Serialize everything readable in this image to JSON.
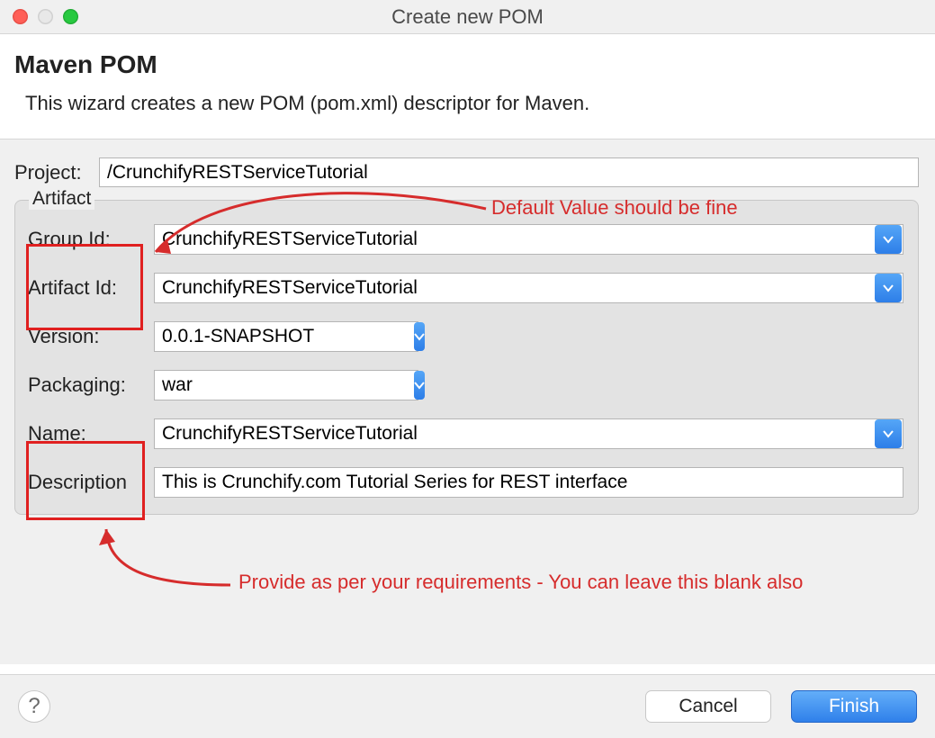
{
  "window": {
    "title": "Create new POM"
  },
  "header": {
    "heading": "Maven POM",
    "sub": "This wizard creates a new POM (pom.xml) descriptor for Maven."
  },
  "form": {
    "project_label": "Project:",
    "project_value": "/CrunchifyRESTServiceTutorial",
    "artifact_legend": "Artifact",
    "fields": {
      "group_id_label": "Group Id:",
      "group_id_value": "CrunchifyRESTServiceTutorial",
      "artifact_id_label": "Artifact Id:",
      "artifact_id_value": "CrunchifyRESTServiceTutorial",
      "version_label": "Version:",
      "version_value": "0.0.1-SNAPSHOT",
      "packaging_label": "Packaging:",
      "packaging_value": "war",
      "name_label": "Name:",
      "name_value": "CrunchifyRESTServiceTutorial",
      "description_label": "Description",
      "description_value": "This is Crunchify.com Tutorial Series for REST interface"
    }
  },
  "annotations": {
    "top": "Default Value should be fine",
    "bottom": "Provide as per your requirements - You can leave this blank also"
  },
  "footer": {
    "help": "?",
    "cancel": "Cancel",
    "finish": "Finish"
  }
}
